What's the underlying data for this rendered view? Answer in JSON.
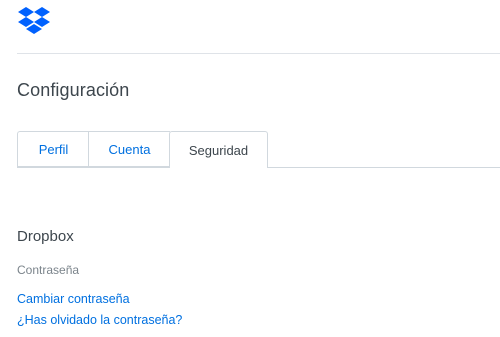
{
  "brand": {
    "logo_icon": "dropbox-logo-icon",
    "color": "#0061fe"
  },
  "page": {
    "title": "Configuración"
  },
  "tabs": [
    {
      "label": "Perfil",
      "active": false
    },
    {
      "label": "Cuenta",
      "active": false
    },
    {
      "label": "Seguridad",
      "active": true
    }
  ],
  "section": {
    "title": "Dropbox",
    "field_label": "Contraseña",
    "links": [
      {
        "label": "Cambiar contraseña"
      },
      {
        "label": "¿Has olvidado la contraseña?"
      }
    ]
  },
  "colors": {
    "link": "#0070e0",
    "text": "#3d464d",
    "muted": "#7b848b",
    "border": "#d1d8de"
  }
}
